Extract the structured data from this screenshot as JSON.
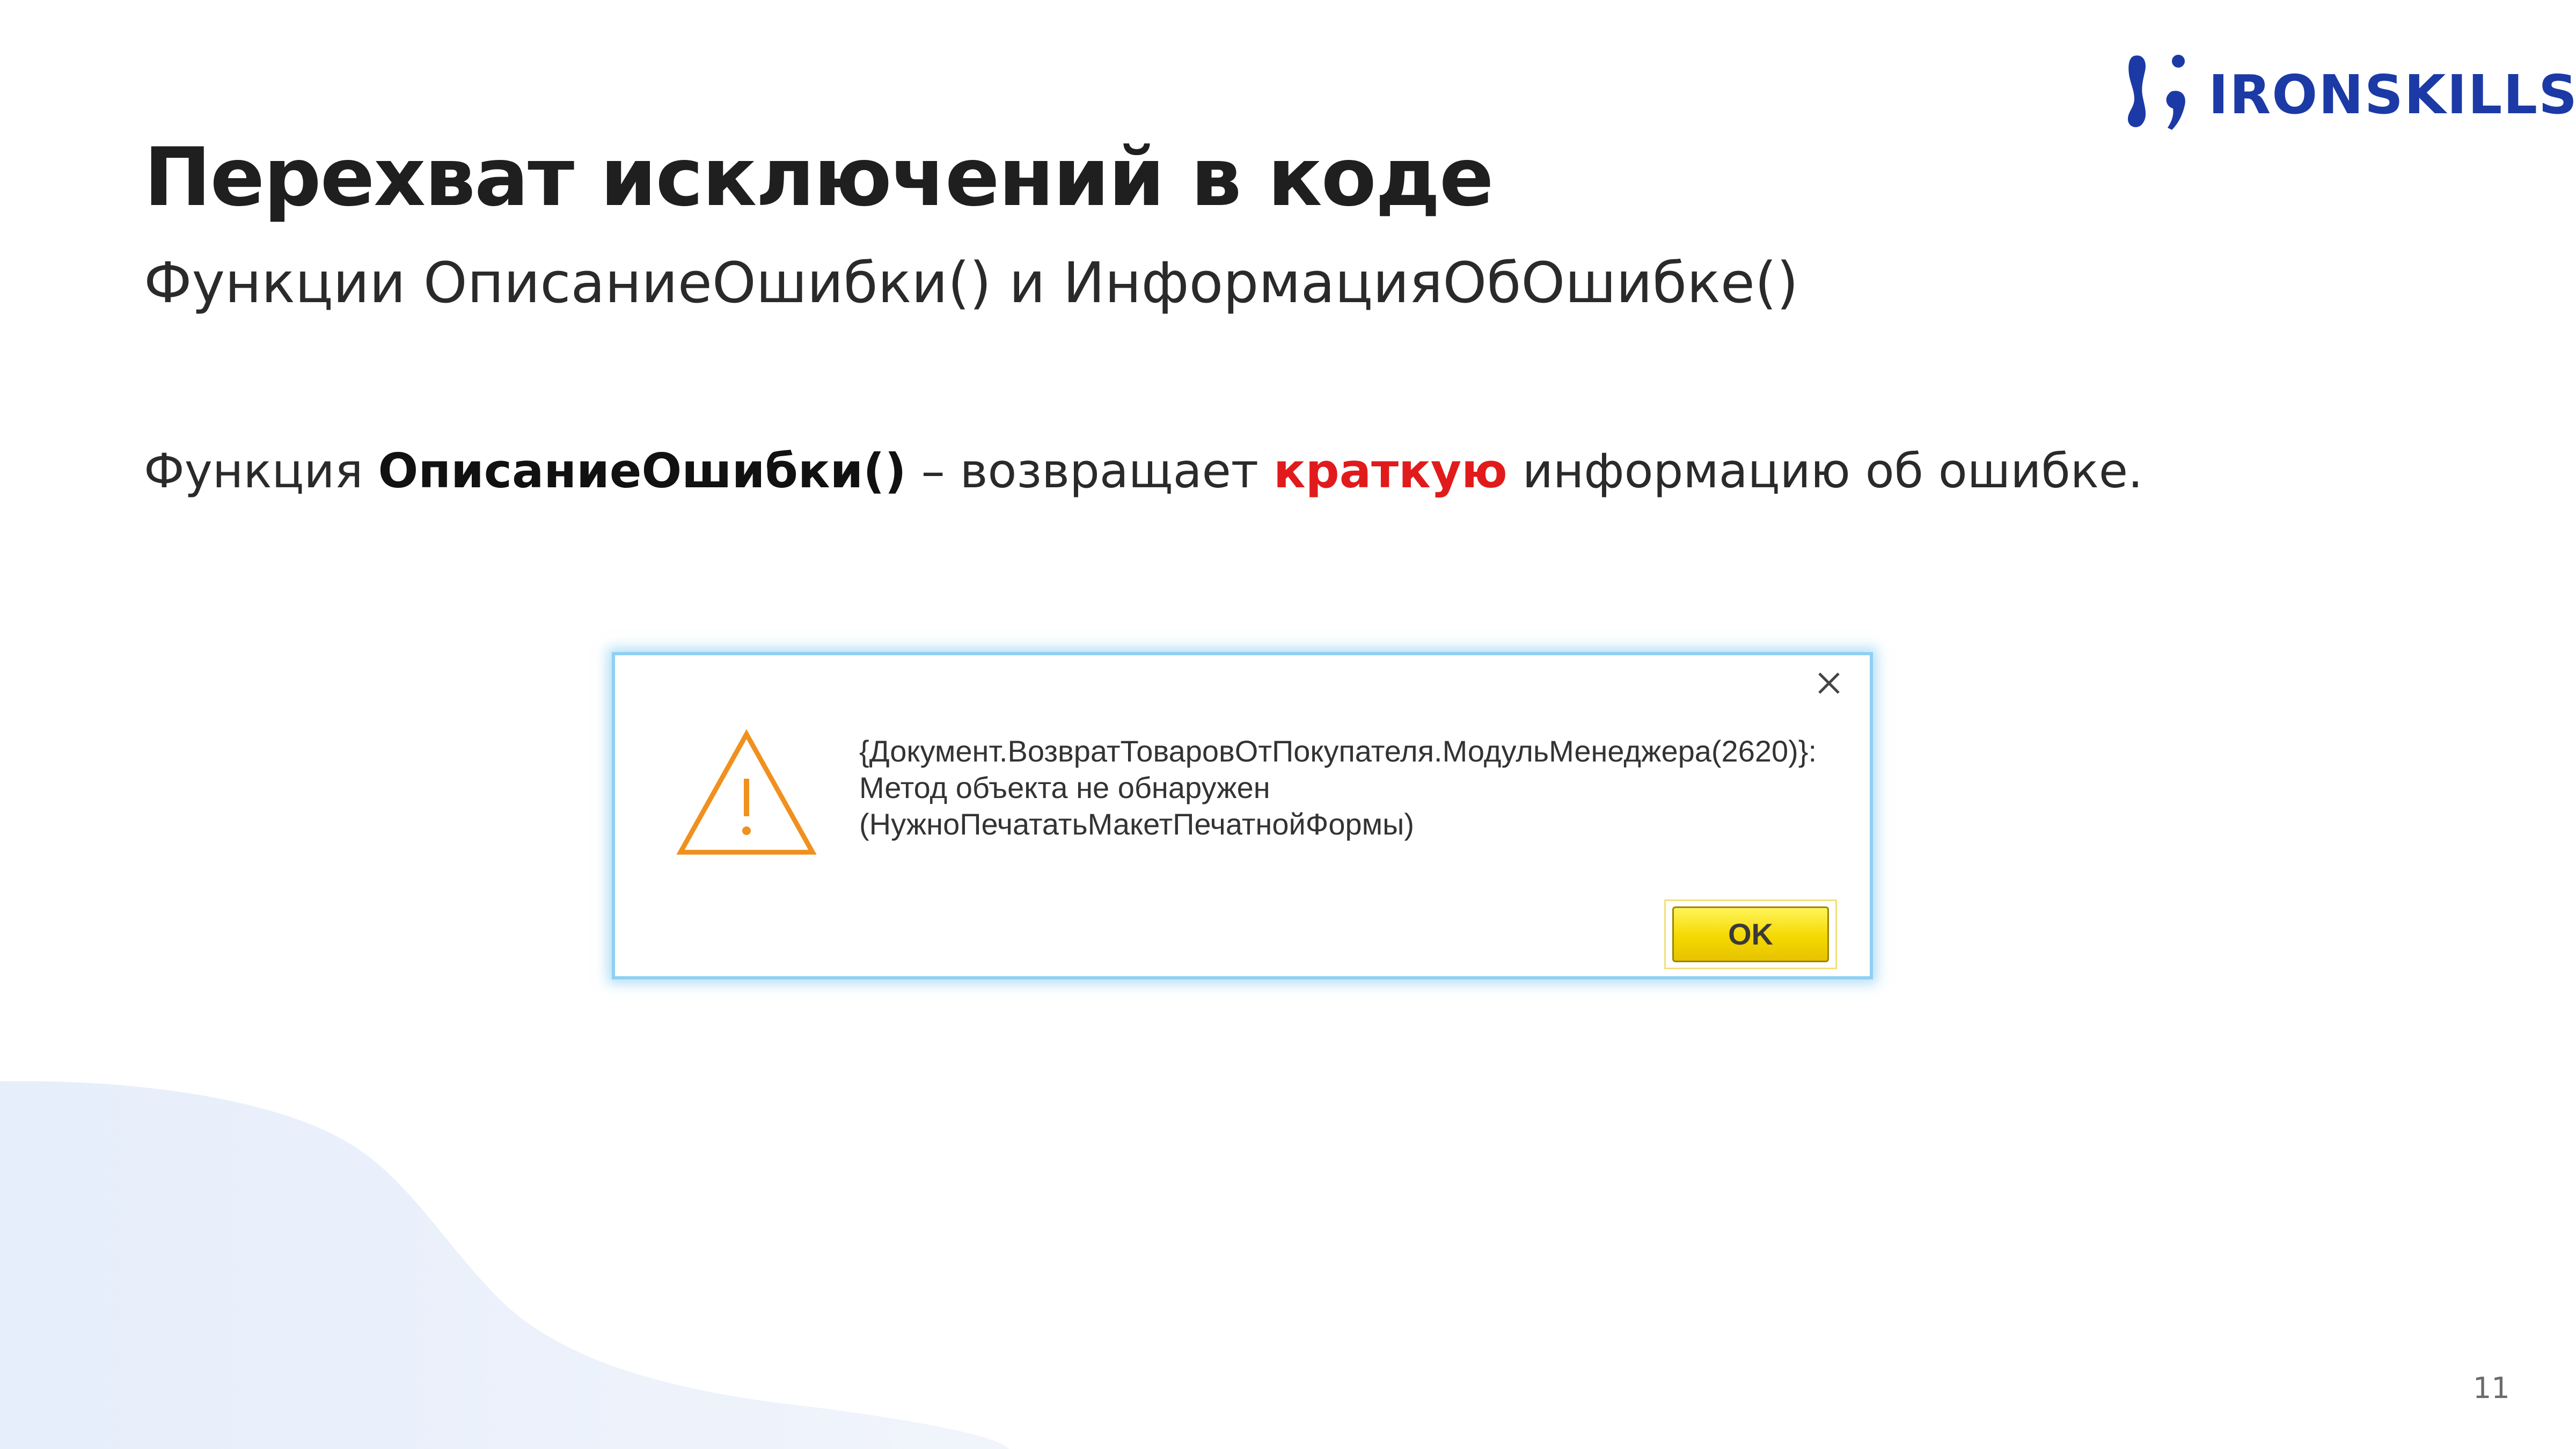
{
  "brand": {
    "name": "IRONSKILLS",
    "color": "#1b3aa6"
  },
  "slide": {
    "title": "Перехват исключений в коде",
    "subtitle": "Функции ОписаниеОшибки() и ИнформацияОбОшибке()",
    "body": {
      "prefix": "Функция ",
      "function_name": "ОписаниеОшибки()",
      "middle": " – возвращает ",
      "highlight": "краткую",
      "suffix": " информацию об ошибке.",
      "highlight_color": "#e11b1b"
    },
    "page_number": "11"
  },
  "dialog": {
    "icon": "warning-icon",
    "icon_color": "#f0901e",
    "message_lines": [
      "{Документ.ВозвратТоваровОтПокупателя.МодульМенеджера(2620)}:",
      "Метод объекта не обнаружен",
      "(НужноПечататьМакетПечатнойФормы)"
    ],
    "ok_label": "OK",
    "close_icon": "close-icon",
    "border_color": "#8fd0f2",
    "ok_color": "#f5d800"
  }
}
